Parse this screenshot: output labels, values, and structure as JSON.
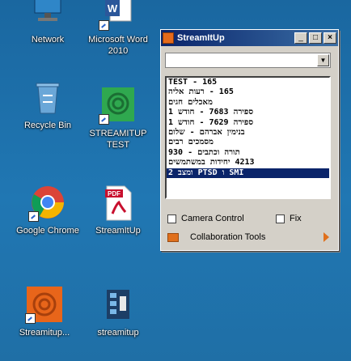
{
  "desktop": {
    "icons": [
      {
        "label": "Network"
      },
      {
        "label": "Microsoft Word\n2010"
      },
      {
        "label": "Recycle Bin"
      },
      {
        "label": "STREAMITUP\nTEST"
      },
      {
        "label": "Google Chrome"
      },
      {
        "label": "StreamItUp"
      },
      {
        "label": "Streamitup..."
      },
      {
        "label": "streamitup"
      }
    ]
  },
  "window": {
    "title": "StreamItUp",
    "minimize": "_",
    "maximize": "□",
    "close": "×",
    "combo_value": "",
    "list_items": [
      "TEST - 165",
      "165 - רעות אליה",
      "מאכלים חגים",
      "ספירה 7683 - חודש 1",
      "ספירה 7629 - חודש 1",
      "בנימין אברהם - שלום",
      "מסמכים רבים",
      "תורה וכתבים - 930",
      "4213 יחידות במשתמשים",
      "SMI ו PTSD ומצב 2"
    ],
    "selected_index": 9,
    "camera_control_label": "Camera Control",
    "fix_label": "Fix",
    "collaboration_label": "Collaboration Tools"
  }
}
